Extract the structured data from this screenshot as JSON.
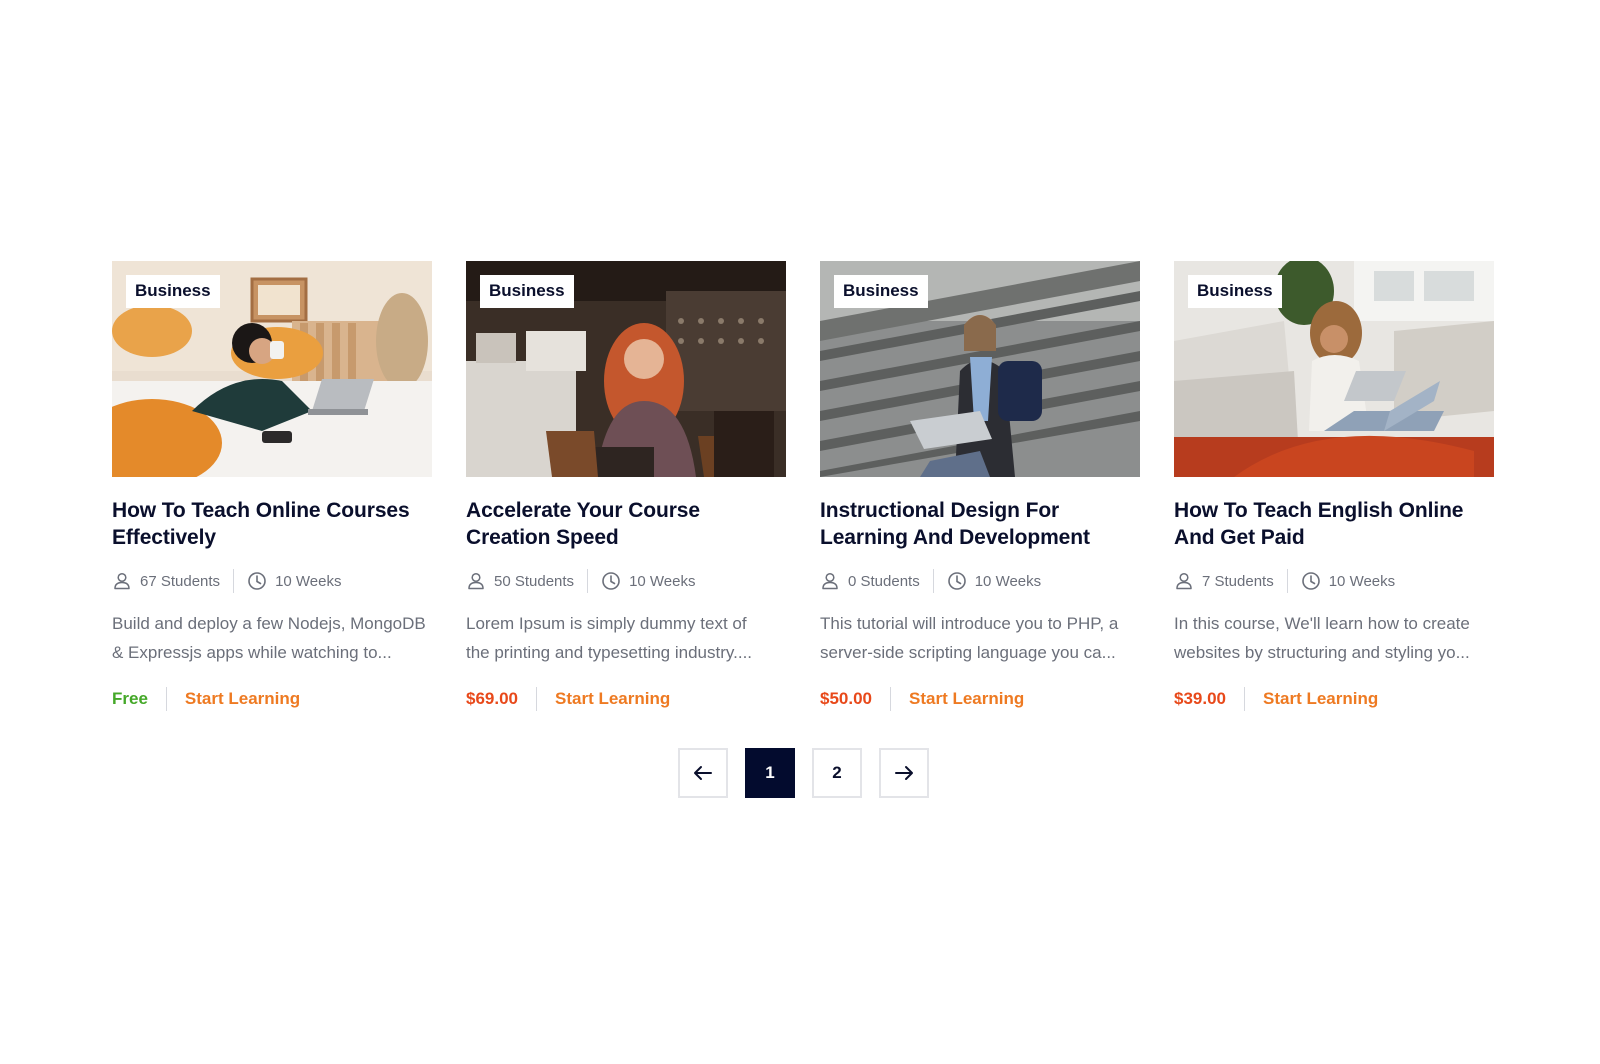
{
  "courses": [
    {
      "category": "Business",
      "title_line1": "How To Teach Online Courses",
      "title_line2": "Effectively",
      "students": "67 Students",
      "duration": "10 Weeks",
      "desc_line1": "Build and deploy a few Nodejs, MongoDB",
      "desc_line2": "& Expressjs apps while watching to...",
      "price": "Free",
      "price_type": "free",
      "cta": "Start Learning",
      "photo": "woman-on-bed-with-laptop"
    },
    {
      "category": "Business",
      "title_line1": "Accelerate Your Course",
      "title_line2": "Creation Speed",
      "students": "50 Students",
      "duration": "10 Weeks",
      "desc_line1": "Lorem Ipsum is simply dummy text of",
      "desc_line2": "the printing and typesetting industry....",
      "price": "$69.00",
      "price_type": "paid",
      "cta": "Start Learning",
      "photo": "woman-in-cafe-with-laptop"
    },
    {
      "category": "Business",
      "title_line1": "Instructional Design For",
      "title_line2": "Learning And Development",
      "students": "0 Students",
      "duration": "10 Weeks",
      "desc_line1": "This tutorial will introduce you to PHP, a",
      "desc_line2": "server-side scripting language you ca...",
      "price": "$50.00",
      "price_type": "paid",
      "cta": "Start Learning",
      "photo": "student-on-stairs-with-laptop"
    },
    {
      "category": "Business",
      "title_line1": "How To Teach English Online",
      "title_line2": "And Get Paid",
      "students": "7 Students",
      "duration": "10 Weeks",
      "desc_line1": "In this course, We'll learn how to create",
      "desc_line2": "websites by structuring and styling yo...",
      "price": "$39.00",
      "price_type": "paid",
      "cta": "Start Learning",
      "photo": "woman-on-floor-with-laptop"
    }
  ],
  "pagination": {
    "prev_icon": "arrow-left-icon",
    "pages": [
      "1",
      "2"
    ],
    "current": "1",
    "next_icon": "arrow-right-icon"
  },
  "colors": {
    "heading": "#0a0f2c",
    "muted": "#6b6f7a",
    "free": "#44a828",
    "price": "#e8491a",
    "cta": "#ee7a22",
    "active_page": "#030b2e"
  }
}
